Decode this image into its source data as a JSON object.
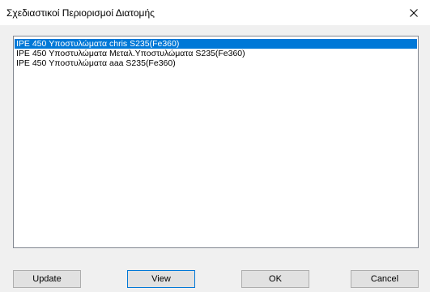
{
  "window": {
    "title": "Σχεδιαστικοί Περιορισμοί Διατομής",
    "close_glyph": "close-icon"
  },
  "list": {
    "items": [
      "IPE 450 Υποστυλώματα chris S235(Fe360)",
      "IPE 450 Υποστυλώματα Μεταλ.Υποστυλώματα S235(Fe360)",
      "IPE 450 Υποστυλώματα aaa S235(Fe360)"
    ],
    "selected_index": 0
  },
  "buttons": {
    "update_label": "Update",
    "view_label": "View",
    "ok_label": "OK",
    "cancel_label": "Cancel"
  },
  "colors": {
    "selection": "#0078d7",
    "focus_border": "#0078d7"
  }
}
